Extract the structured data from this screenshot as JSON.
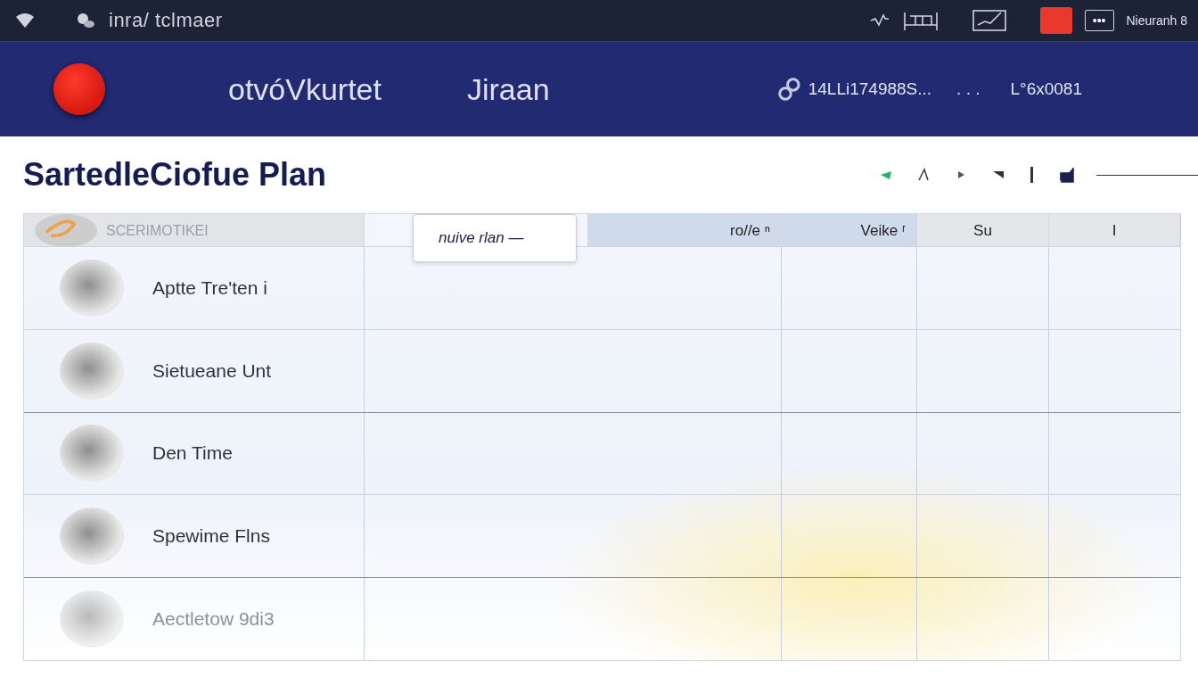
{
  "top_bar": {
    "title": "inra/ tclmaer",
    "user": "Nieuranh 8",
    "more_button": "•••"
  },
  "header": {
    "brand": "otvóVkurtet",
    "section": "Jiraan",
    "code": "14LLi174988S...",
    "separator": ". . .",
    "id": "L°6x0081"
  },
  "page": {
    "title": "SartedleCiofue Plan"
  },
  "table": {
    "columns": [
      {
        "label": "SCERIMOTIKEI",
        "kind": "icon"
      },
      {
        "label": "nuive rlan —",
        "kind": "popup"
      },
      {
        "label": "ro//e ⁿ",
        "kind": "plain"
      },
      {
        "label": "Veike ʳ",
        "kind": "plain"
      },
      {
        "label": "Su",
        "kind": "grey"
      },
      {
        "label": "I",
        "kind": "grey"
      }
    ],
    "rows": [
      {
        "name": "Aptte Tre'ten i",
        "disabled": false
      },
      {
        "name": "Sietueane Unt",
        "disabled": false
      },
      {
        "name": "Den Time",
        "disabled": false
      },
      {
        "name": "Spewime Flns",
        "disabled": false
      },
      {
        "name": "Aectletow 9di3",
        "disabled": true
      }
    ]
  }
}
